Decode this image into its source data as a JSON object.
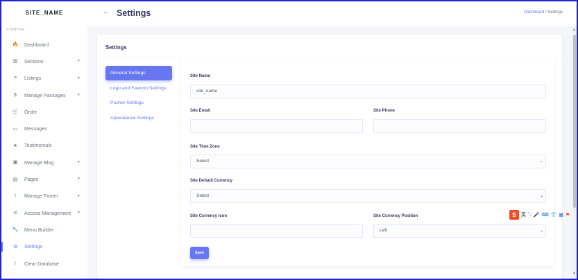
{
  "sidebar": {
    "brand": "SITE_NAME",
    "section_header": "STARTER",
    "items": [
      {
        "label": "Dashboard",
        "icon": "fire-icon",
        "glyph": "🔥",
        "has_caret": false,
        "active": false
      },
      {
        "label": "Sections",
        "icon": "columns-icon",
        "glyph": "▥",
        "has_caret": true,
        "active": false
      },
      {
        "label": "Listings",
        "icon": "list-icon",
        "glyph": "≡",
        "has_caret": true,
        "active": false
      },
      {
        "label": "Manage Packages",
        "icon": "dollar-icon",
        "glyph": "$",
        "has_caret": true,
        "active": false
      },
      {
        "label": "Order",
        "icon": "cart-icon",
        "glyph": "🛒",
        "has_caret": false,
        "active": false
      },
      {
        "label": "Messages",
        "icon": "inbox-icon",
        "glyph": "▭",
        "has_caret": false,
        "active": false
      },
      {
        "label": "Testimonials",
        "icon": "star-icon",
        "glyph": "★",
        "has_caret": false,
        "active": false
      },
      {
        "label": "Manage Blog",
        "icon": "blog-icon",
        "glyph": "▣",
        "has_caret": true,
        "active": false
      },
      {
        "label": "Pages",
        "icon": "file-icon",
        "glyph": "▤",
        "has_caret": true,
        "active": false
      },
      {
        "label": "Manage Footer",
        "icon": "info-icon",
        "glyph": "i",
        "has_caret": true,
        "active": false
      },
      {
        "label": "Access Management",
        "icon": "ban-icon",
        "glyph": "⊘",
        "has_caret": true,
        "active": false
      },
      {
        "label": "Menu Builder",
        "icon": "wrench-icon",
        "glyph": "🔧",
        "has_caret": false,
        "active": false
      },
      {
        "label": "Settings",
        "icon": "cog-icon",
        "glyph": "⚙",
        "has_caret": false,
        "active": true
      },
      {
        "label": "Clear Database",
        "icon": "exclamation-icon",
        "glyph": "!",
        "has_caret": false,
        "active": false
      }
    ]
  },
  "header": {
    "back_glyph": "←",
    "title": "Settings",
    "breadcrumb_link": "Dashboard",
    "breadcrumb_sep": "/",
    "breadcrumb_current": "Settings"
  },
  "card": {
    "title": "Settings",
    "tabs": [
      {
        "label": "General Settings",
        "active": true
      },
      {
        "label": "Logo and Favicon Settings",
        "active": false
      },
      {
        "label": "Pusher Settings",
        "active": false
      },
      {
        "label": "Appearance Settings",
        "active": false
      }
    ]
  },
  "form": {
    "site_name": {
      "label": "Site Name",
      "value": "site_name"
    },
    "site_email": {
      "label": "Site Email",
      "value": ""
    },
    "site_phone": {
      "label": "Site Phone",
      "value": ""
    },
    "site_time_zone": {
      "label": "Site Time Zone",
      "value": "Select"
    },
    "site_default_currency": {
      "label": "Site Default Currency",
      "value": "Select"
    },
    "site_currency_icon": {
      "label": "Site Currency Icon",
      "value": ""
    },
    "site_currency_position": {
      "label": "Site Currency Position",
      "value": "Left"
    },
    "save_label": "Save"
  },
  "ime": {
    "logo": "S",
    "mode": "英"
  },
  "colors": {
    "accent": "#6777ef",
    "frame": "#1f1fd0",
    "ime": "#ef4d23"
  }
}
